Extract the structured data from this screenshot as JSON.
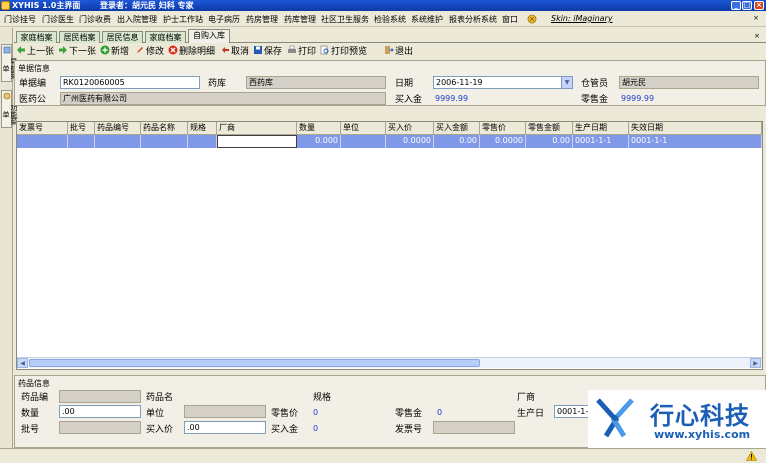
{
  "window": {
    "app_title": "XYHIS 1.0主界面",
    "user_info": "登录者：胡元民    妇科    专家"
  },
  "menu": {
    "items": [
      "门诊挂号",
      "门诊医生",
      "门诊收费",
      "出入院管理",
      "护士工作站",
      "电子病历",
      "药房管理",
      "药库管理",
      "社区卫生服务",
      "检验系统",
      "系统维护",
      "报表分析系统",
      "窗口"
    ],
    "skin_label": "Skin: iMaginary"
  },
  "sidebar": {
    "tabs": [
      "导航菜单",
      "功能菜单"
    ]
  },
  "tabs": [
    "家庭档案",
    "居民档案",
    "居民信息",
    "家庭档案",
    "自购入库"
  ],
  "toolbar": {
    "prev": "上一张",
    "next": "下一张",
    "add": "新增",
    "edit": "修改",
    "delete_detail": "删除明细",
    "cancel": "取消",
    "save": "保存",
    "print": "打印",
    "print_preview": "打印预览",
    "exit": "退出"
  },
  "doc_info": {
    "section_title": "单据信息",
    "doc_no_label": "单据编",
    "doc_no_value": "RK0120060005",
    "storage_label": "药库",
    "storage_value": "西药库",
    "date_label": "日期",
    "date_value": "2006-11-19",
    "keeper_label": "仓管员",
    "keeper_value": "胡元民",
    "supplier_label": "医药公",
    "supplier_value": "广州医药有限公司",
    "purchase_total_label": "买入金",
    "purchase_total_value": "9999.99",
    "retail_total_label": "零售金",
    "retail_total_value": "9999.99"
  },
  "grid": {
    "columns": [
      "发票号",
      "批号",
      "药品编号",
      "药品名称",
      "规格",
      "厂商",
      "数量",
      "单位",
      "买入价",
      "买入金额",
      "零售价",
      "零售金额",
      "生产日期",
      "失效日期"
    ],
    "row": [
      "",
      "",
      "",
      "",
      "",
      "",
      "0.000",
      "",
      "0.0000",
      "0.00",
      "0.0000",
      "0.00",
      "0001-1-1",
      "0001-1-1"
    ]
  },
  "drug_info": {
    "section_title": "药品信息",
    "drug_code_label": "药品编",
    "drug_code_value": "",
    "drug_name_label": "药品名",
    "spec_label": "规格",
    "manufacturer_label": "厂商",
    "qty_label": "数量",
    "qty_value": ".00",
    "unit_label": "单位",
    "retail_price_label": "零售价",
    "retail_price_value": "0",
    "retail_amount_label": "零售金",
    "retail_amount_value": "0",
    "prod_date_label": "生产日",
    "prod_date_value": "0001-1-1",
    "batch_label": "批号",
    "buy_price_label": "买入价",
    "buy_price_value": ".00",
    "buy_amount_label": "买入金",
    "buy_amount_value": "0",
    "invoice_label": "发票号"
  },
  "logo": {
    "company": "行心科技",
    "url": "www.xyhis.com"
  },
  "colors": {
    "title_blue": "#0a3aa8",
    "selected_row": "#7f99e8",
    "value_blue": "#1e3ccc",
    "tab_green": "#d7e7cf",
    "logo_blue": "#1b5fb5"
  }
}
